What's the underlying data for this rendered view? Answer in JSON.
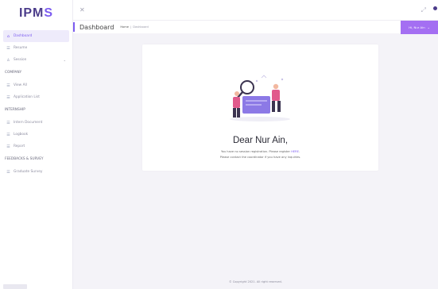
{
  "app": {
    "logo_main": "IPM",
    "logo_accent": "S"
  },
  "sidebar": {
    "items": [
      {
        "label": "Dashboard",
        "icon": "home-icon",
        "active": true
      },
      {
        "label": "Resume",
        "icon": "list-icon"
      },
      {
        "label": "Session",
        "icon": "user-icon",
        "has_chevron": true
      }
    ],
    "company": {
      "title": "COMPANY",
      "items": [
        {
          "label": "View All",
          "icon": "list-icon"
        },
        {
          "label": "Application List",
          "icon": "list-icon"
        }
      ]
    },
    "internship": {
      "title": "INTERNSHIP",
      "items": [
        {
          "label": "Intern Document",
          "icon": "list-icon"
        },
        {
          "label": "Logbook",
          "icon": "list-icon"
        },
        {
          "label": "Report",
          "icon": "list-icon"
        }
      ]
    },
    "feedback": {
      "title": "FEEDBACKS & SURVEY",
      "items": [
        {
          "label": "Graduate Survey",
          "icon": "list-icon"
        }
      ]
    }
  },
  "header": {
    "title": "Dashboard",
    "breadcrumb_home": "Home",
    "breadcrumb_sep": "|",
    "breadcrumb_current": "Dashboard",
    "user_chip": "Hi, Nur Ain",
    "user_chevron": "⌄"
  },
  "card": {
    "greeting": "Dear Nur Ain,",
    "message_prefix": "You have no session registration. Please register ",
    "message_link": "HERE",
    "message_suffix": ".",
    "message_line2": "Please contact the coordinator if you have any inquiries."
  },
  "footer": {
    "text": "© Copyright 2021. All right reserved."
  },
  "colors": {
    "accent": "#7c5cf0",
    "logo": "#4b3c8a",
    "chip": "#a46ff2"
  }
}
